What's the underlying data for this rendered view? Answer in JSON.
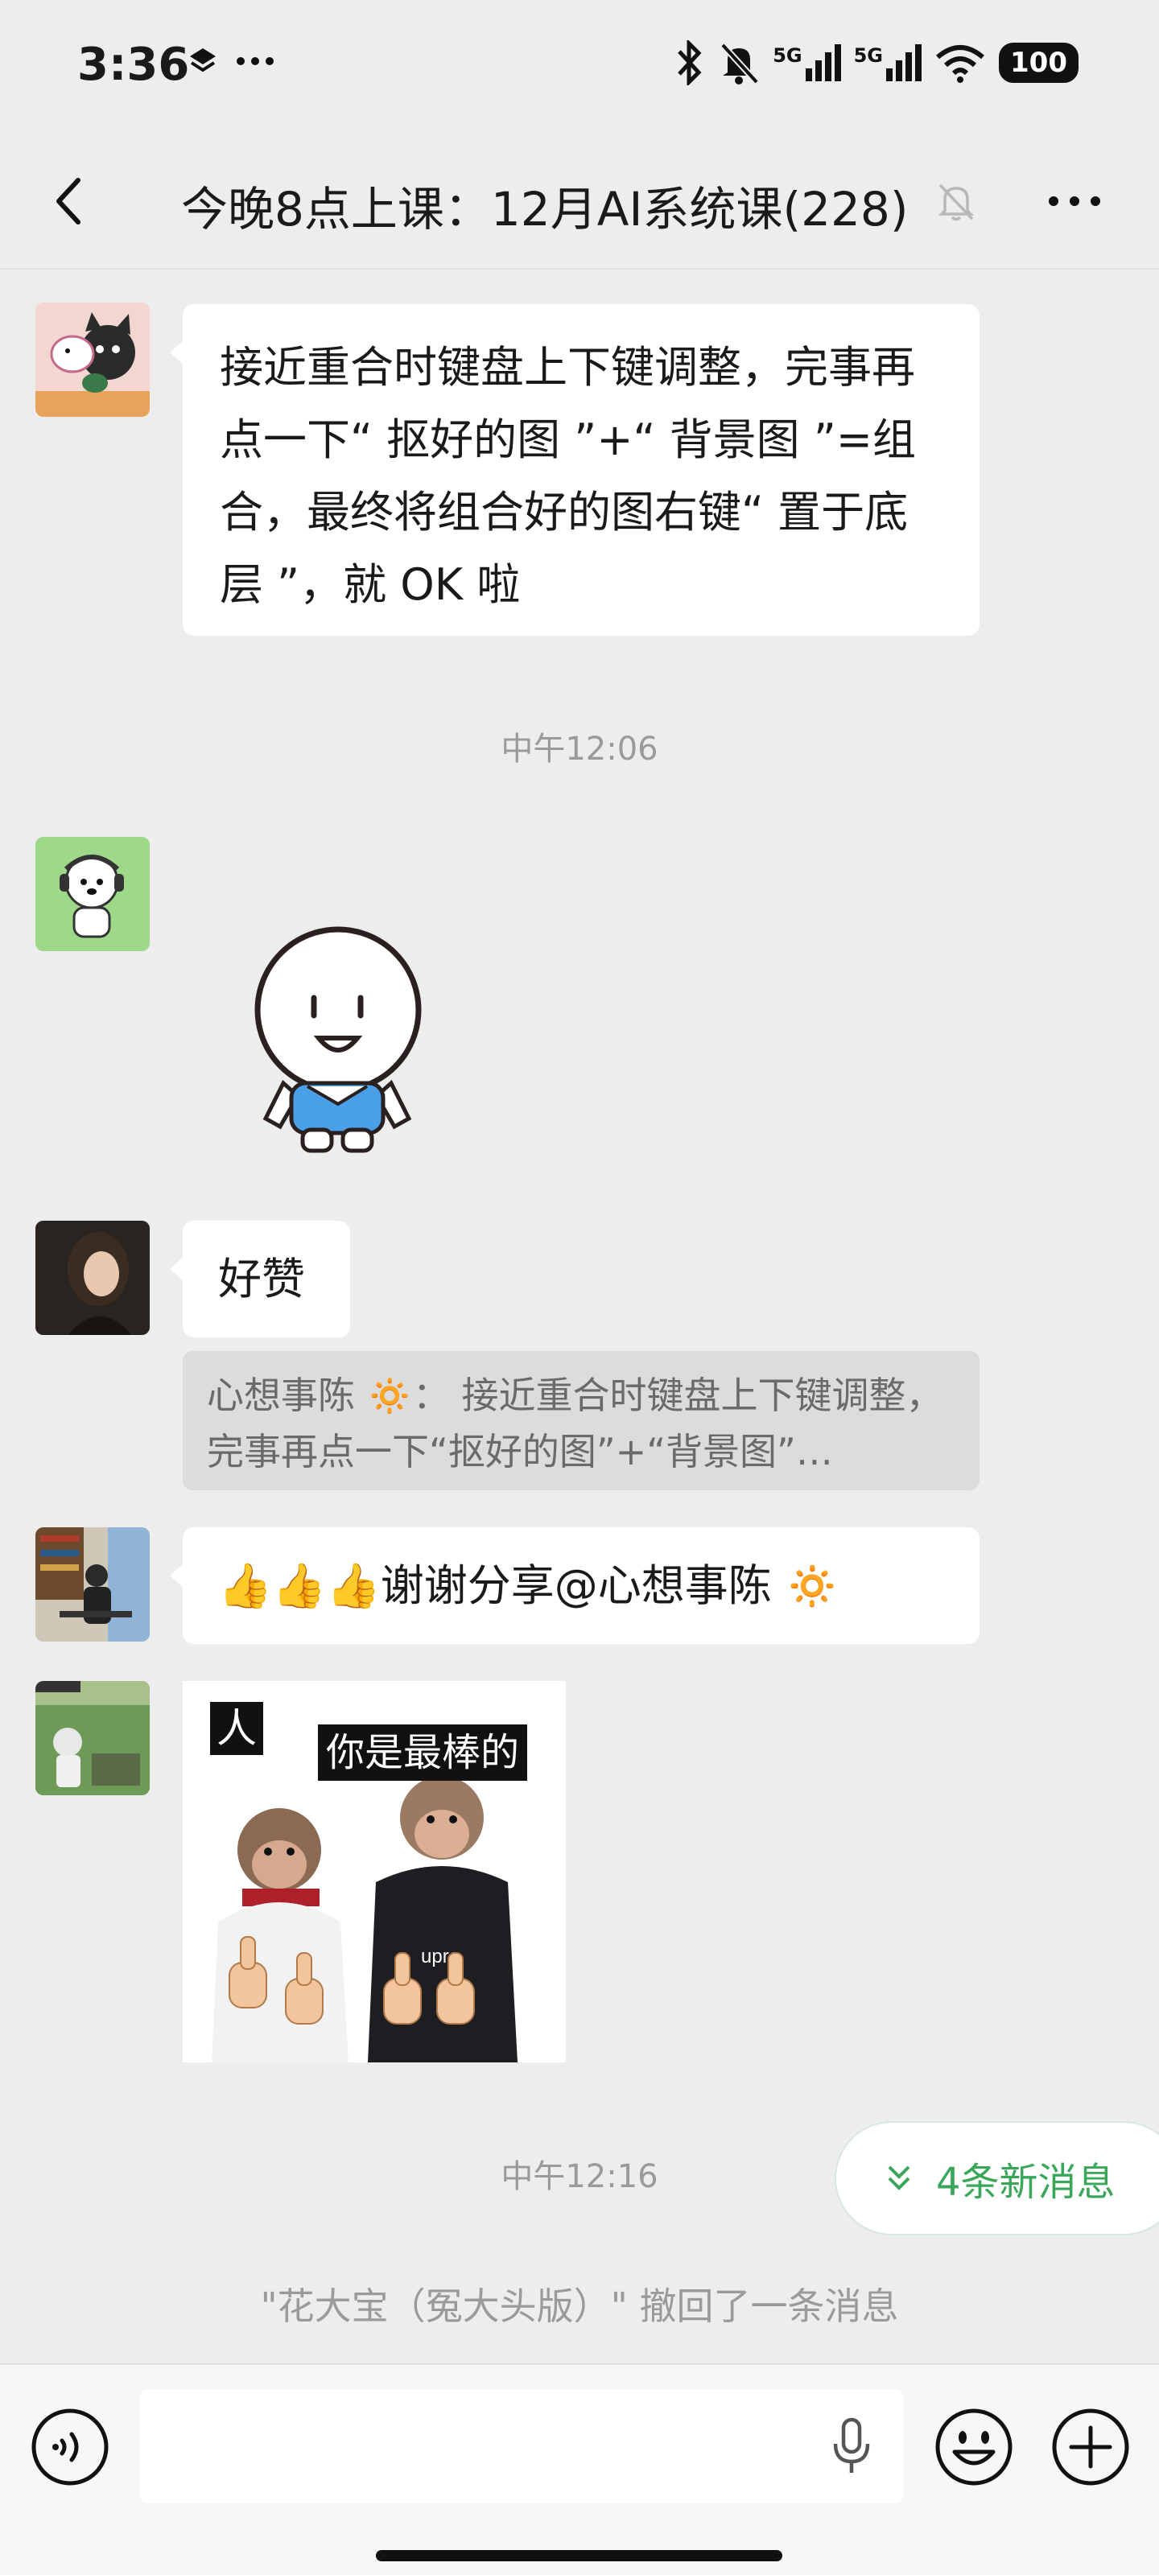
{
  "status_bar": {
    "time": "3:36",
    "network_1": "5G",
    "network_2": "5G",
    "battery": "100"
  },
  "nav": {
    "title": "今晚8点上课：12月AI系统课(228)"
  },
  "messages": [
    {
      "type": "text",
      "text": "接近重合时键盘上下键调整，完事再点一下“ 抠好的图 ”+“ 背景图 ”=组合，最终将组合好的图右键“ 置于底层 ”，就 OK 啦"
    },
    {
      "type": "sticker",
      "sticker": "smiling-character"
    },
    {
      "type": "text",
      "text": "好赞",
      "quote": "心想事陈 🔅： 接近重合时键盘上下键调整，完事再点一下“抠好的图”+“背景图”…"
    },
    {
      "type": "text",
      "emoji": "👍👍👍",
      "text": "谢谢分享@心想事陈 🔅"
    },
    {
      "type": "image",
      "caption_left": "人",
      "caption_right": "你是最棒的",
      "shirt_text": "upre"
    }
  ],
  "timestamps": {
    "t1": "中午12:06",
    "t2": "中午12:16"
  },
  "new_messages": "4条新消息",
  "recall_notice": "\"花大宝（冤大头版）\" 撤回了一条消息",
  "colors": {
    "background": "#ededed",
    "bubble": "#ffffff",
    "accent_green": "#3aa65a"
  }
}
